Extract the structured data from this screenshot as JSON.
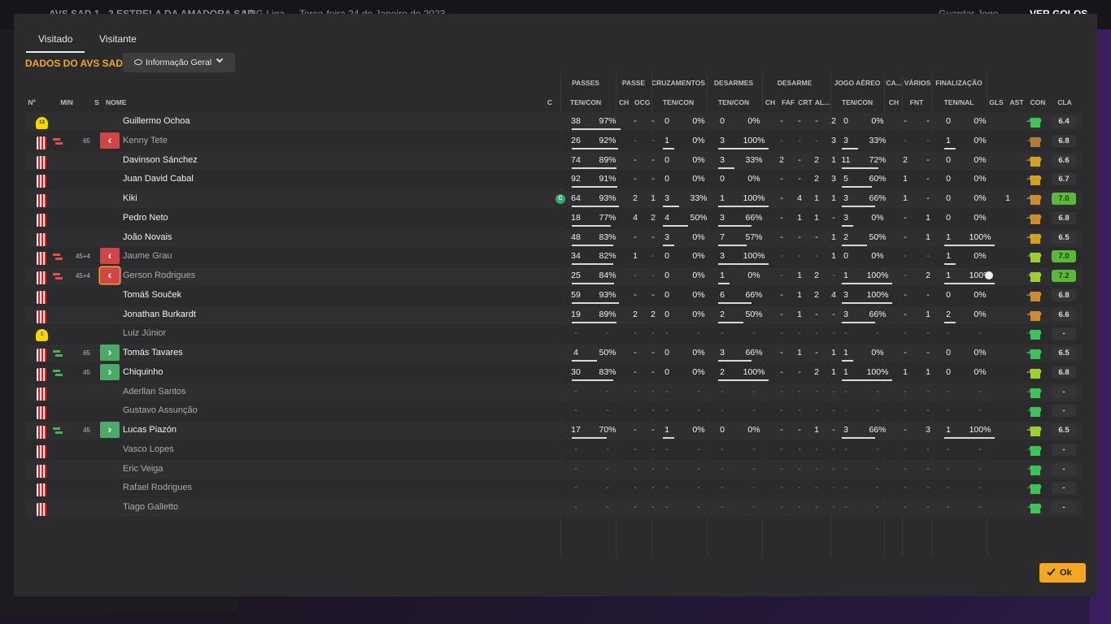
{
  "background": {
    "match": "AVS SAD  1 - 2  ESTRELA DA AMADORA SAD",
    "competition": "LPG Liga",
    "date": "Terça-feira 24 de Janeiro de 2023",
    "save_label": "Guardar Jogo",
    "goals_label": "VER GOLOS"
  },
  "tabs": [
    {
      "label": "Visitado",
      "active": true
    },
    {
      "label": "Visitante",
      "active": false
    }
  ],
  "title": "DADOS DO AVS SAD",
  "view_select": {
    "value": "Informação Geral"
  },
  "groups": {
    "passes": "PASSES",
    "passe": "PASSE",
    "cruz": "CRUZAMENTOS",
    "des": "DESARMES",
    "desarme": "DESARME",
    "aereo": "JOGO AÉREO",
    "ca": "CA...",
    "varios": "VÁRIOS",
    "final": "FINALIZAÇÃO"
  },
  "headers": {
    "num": "Nº",
    "min": "MIN",
    "s": "S",
    "nome": "NOME",
    "c": "C",
    "passes": "TEN/CON",
    "ch1": "CH",
    "ocg": "OCG",
    "cruz": "TEN/CON",
    "des": "TEN/CON",
    "ch2": "CH",
    "faf": "FAF",
    "crt": "CRT",
    "al": "AL...",
    "aereo": "TEN/CON",
    "ch3": "CH",
    "fnt": "FNT",
    "final": "TEN/NAL",
    "gls": "GLS",
    "ast": "AST",
    "con": "CON",
    "cla": "CLA"
  },
  "colors": {
    "accent": "#f5a623",
    "sub_in": "#4aaa66",
    "sub_out": "#d04545"
  },
  "players": [
    {
      "n": "13",
      "gk": true,
      "min": "",
      "sub": "",
      "name": "Guillermo Ochoa",
      "dim": false,
      "cap": false,
      "p": [
        "38",
        "97%",
        0.97
      ],
      "ch1": "-",
      "ocg": "-",
      "cz": [
        "0",
        "0%",
        0
      ],
      "ds": [
        "0",
        "0%",
        0
      ],
      "dch": "-",
      "faf": "-",
      "crt": "-",
      "al": "2",
      "ae": [
        "0",
        "0%",
        0
      ],
      "ca": "-",
      "fnt": "-",
      "fi": [
        "0",
        "0%",
        0
      ],
      "gls": "",
      "ast": "-",
      "con": "#3ec25a",
      "cla": "6.4",
      "good": false,
      "ball": false
    },
    {
      "n": "",
      "gk": false,
      "min": "65",
      "sub": "out",
      "name": "Kenny Tete",
      "dim": true,
      "cap": false,
      "p": [
        "26",
        "92%",
        0.92
      ],
      "ch1": "-",
      "ocg": "-",
      "cz": [
        "1",
        "0%",
        0
      ],
      "ds": [
        "3",
        "100%",
        1
      ],
      "dch": "-",
      "faf": "-",
      "crt": "-",
      "al": "3",
      "ae": [
        "3",
        "33%",
        0.33
      ],
      "ca": "-",
      "fnt": "-",
      "fi": [
        "1",
        "0%",
        0
      ],
      "gls": "",
      "ast": "-",
      "con": "#b07a3a",
      "cla": "6.8",
      "good": false,
      "ball": false
    },
    {
      "n": "",
      "gk": false,
      "min": "",
      "sub": "",
      "name": "Davinson Sánchez",
      "dim": false,
      "cap": false,
      "p": [
        "74",
        "89%",
        0.89
      ],
      "ch1": "-",
      "ocg": "-",
      "cz": [
        "0",
        "0%",
        0
      ],
      "ds": [
        "3",
        "33%",
        0.33
      ],
      "dch": "2",
      "faf": "-",
      "crt": "2",
      "al": "1",
      "ae": [
        "11",
        "72%",
        0.72
      ],
      "ca": "2",
      "fnt": "-",
      "fi": [
        "0",
        "0%",
        0
      ],
      "gls": "",
      "ast": "-",
      "con": "#d4a020",
      "cla": "6.6",
      "good": false,
      "ball": false
    },
    {
      "n": "",
      "gk": false,
      "min": "",
      "sub": "",
      "name": "Juan David Cabal",
      "dim": false,
      "cap": false,
      "p": [
        "92",
        "91%",
        0.91
      ],
      "ch1": "-",
      "ocg": "-",
      "cz": [
        "0",
        "0%",
        0
      ],
      "ds": [
        "0",
        "0%",
        0
      ],
      "dch": "-",
      "faf": "-",
      "crt": "2",
      "al": "3",
      "ae": [
        "5",
        "60%",
        0.6
      ],
      "ca": "1",
      "fnt": "-",
      "fi": [
        "0",
        "0%",
        0
      ],
      "gls": "",
      "ast": "-",
      "con": "#d4a020",
      "cla": "6.7",
      "good": false,
      "ball": false
    },
    {
      "n": "",
      "gk": false,
      "min": "",
      "sub": "",
      "name": "Kiki",
      "dim": false,
      "cap": true,
      "p": [
        "64",
        "93%",
        0.93
      ],
      "ch1": "2",
      "ocg": "1",
      "cz": [
        "3",
        "33%",
        0.33
      ],
      "ds": [
        "1",
        "100%",
        1
      ],
      "dch": "-",
      "faf": "4",
      "crt": "1",
      "al": "1",
      "ae": [
        "3",
        "66%",
        0.66
      ],
      "ca": "1",
      "fnt": "-",
      "fi": [
        "0",
        "0%",
        0
      ],
      "gls": "1",
      "ast": "-",
      "con": "#d08a30",
      "cla": "7.0",
      "good": true,
      "ball": false
    },
    {
      "n": "",
      "gk": false,
      "min": "",
      "sub": "",
      "name": "Pedro Neto",
      "dim": false,
      "cap": false,
      "p": [
        "18",
        "77%",
        0.77
      ],
      "ch1": "4",
      "ocg": "2",
      "cz": [
        "4",
        "50%",
        0.5
      ],
      "ds": [
        "3",
        "66%",
        0.66
      ],
      "dch": "-",
      "faf": "1",
      "crt": "1",
      "al": "-",
      "ae": [
        "3",
        "0%",
        0
      ],
      "ca": "-",
      "fnt": "1",
      "fi": [
        "0",
        "0%",
        0
      ],
      "gls": "",
      "ast": "-",
      "con": "#d08a30",
      "cla": "6.8",
      "good": false,
      "ball": false
    },
    {
      "n": "",
      "gk": false,
      "min": "",
      "sub": "",
      "name": "João Novais",
      "dim": false,
      "cap": false,
      "p": [
        "48",
        "83%",
        0.83
      ],
      "ch1": "-",
      "ocg": "-",
      "cz": [
        "3",
        "0%",
        0
      ],
      "ds": [
        "7",
        "57%",
        0.57
      ],
      "dch": "-",
      "faf": "-",
      "crt": "-",
      "al": "1",
      "ae": [
        "2",
        "50%",
        0.5
      ],
      "ca": "-",
      "fnt": "1",
      "fi": [
        "1",
        "100%",
        1
      ],
      "gls": "",
      "ast": "-",
      "con": "#d4a020",
      "cla": "6.5",
      "good": false,
      "ball": false
    },
    {
      "n": "",
      "gk": false,
      "min": "45+4",
      "sub": "out",
      "name": "Jaume Grau",
      "dim": true,
      "cap": false,
      "p": [
        "34",
        "82%",
        0.82
      ],
      "ch1": "1",
      "ocg": "-",
      "cz": [
        "0",
        "0%",
        0
      ],
      "ds": [
        "3",
        "100%",
        1
      ],
      "dch": "-",
      "faf": "-",
      "crt": "-",
      "al": "1",
      "ae": [
        "0",
        "0%",
        0
      ],
      "ca": "-",
      "fnt": "-",
      "fi": [
        "1",
        "0%",
        0
      ],
      "gls": "",
      "ast": "-",
      "con": "#9ad030",
      "cla": "7.0",
      "good": true,
      "ball": false
    },
    {
      "n": "",
      "gk": false,
      "min": "45+4",
      "sub": "out",
      "hl": true,
      "name": "Gerson Rodrigues",
      "dim": true,
      "cap": false,
      "p": [
        "25",
        "84%",
        0.84
      ],
      "ch1": "-",
      "ocg": "-",
      "cz": [
        "0",
        "0%",
        0
      ],
      "ds": [
        "1",
        "0%",
        0
      ],
      "dch": "-",
      "faf": "1",
      "crt": "2",
      "al": "-",
      "ae": [
        "1",
        "100%",
        1
      ],
      "ca": "-",
      "fnt": "2",
      "fi": [
        "1",
        "100%",
        1
      ],
      "gls": "",
      "ast": "-",
      "con": "#9ad030",
      "cla": "7.2",
      "good": true,
      "ball": true
    },
    {
      "n": "",
      "gk": false,
      "min": "",
      "sub": "",
      "name": "Tomáš Souček",
      "dim": false,
      "cap": false,
      "p": [
        "59",
        "93%",
        0.93
      ],
      "ch1": "-",
      "ocg": "-",
      "cz": [
        "0",
        "0%",
        0
      ],
      "ds": [
        "6",
        "66%",
        0.66
      ],
      "dch": "-",
      "faf": "1",
      "crt": "2",
      "al": "4",
      "ae": [
        "3",
        "100%",
        1
      ],
      "ca": "-",
      "fnt": "-",
      "fi": [
        "0",
        "0%",
        0
      ],
      "gls": "",
      "ast": "-",
      "con": "#d08a30",
      "cla": "6.8",
      "good": false,
      "ball": false
    },
    {
      "n": "",
      "gk": false,
      "min": "",
      "sub": "",
      "name": "Jonathan Burkardt",
      "dim": false,
      "cap": false,
      "p": [
        "19",
        "89%",
        0.89
      ],
      "ch1": "2",
      "ocg": "2",
      "cz": [
        "0",
        "0%",
        0
      ],
      "ds": [
        "2",
        "50%",
        0.5
      ],
      "dch": "-",
      "faf": "1",
      "crt": "-",
      "al": "-",
      "ae": [
        "3",
        "66%",
        0.66
      ],
      "ca": "-",
      "fnt": "1",
      "fi": [
        "2",
        "0%",
        0
      ],
      "gls": "",
      "ast": "-",
      "con": "#d08a30",
      "cla": "6.6",
      "good": false,
      "ball": false
    },
    {
      "n": "1",
      "gk": true,
      "min": "",
      "sub": "",
      "name": "Luiz Júnior",
      "dim": true,
      "cap": false,
      "p": [
        "-",
        "-",
        0
      ],
      "ch1": "-",
      "ocg": "-",
      "cz": [
        "-",
        "-",
        0
      ],
      "ds": [
        "-",
        "-",
        0
      ],
      "dch": "-",
      "faf": "-",
      "crt": "-",
      "al": "-",
      "ae": [
        "-",
        "-",
        0
      ],
      "ca": "-",
      "fnt": "-",
      "fi": [
        "-",
        "-",
        0
      ],
      "gls": "",
      "ast": "-",
      "con": "#3ec25a",
      "cla": "-",
      "good": false,
      "ball": false
    },
    {
      "n": "",
      "gk": false,
      "min": "65",
      "sub": "in",
      "name": "Tomás Tavares",
      "dim": false,
      "cap": false,
      "p": [
        "4",
        "50%",
        0.5
      ],
      "ch1": "-",
      "ocg": "-",
      "cz": [
        "0",
        "0%",
        0
      ],
      "ds": [
        "3",
        "66%",
        0.66
      ],
      "dch": "-",
      "faf": "1",
      "crt": "-",
      "al": "1",
      "ae": [
        "1",
        "0%",
        0
      ],
      "ca": "-",
      "fnt": "-",
      "fi": [
        "0",
        "0%",
        0
      ],
      "gls": "",
      "ast": "-",
      "con": "#3ec25a",
      "cla": "6.5",
      "good": false,
      "ball": false
    },
    {
      "n": "",
      "gk": false,
      "min": "45",
      "sub": "in",
      "name": "Chiquinho",
      "dim": false,
      "cap": false,
      "p": [
        "30",
        "83%",
        0.83
      ],
      "ch1": "-",
      "ocg": "-",
      "cz": [
        "0",
        "0%",
        0
      ],
      "ds": [
        "2",
        "100%",
        1
      ],
      "dch": "-",
      "faf": "-",
      "crt": "2",
      "al": "1",
      "ae": [
        "1",
        "100%",
        1
      ],
      "ca": "1",
      "fnt": "1",
      "fi": [
        "0",
        "0%",
        0
      ],
      "gls": "",
      "ast": "-",
      "con": "#9ad030",
      "cla": "6.8",
      "good": false,
      "ball": false
    },
    {
      "n": "",
      "gk": false,
      "min": "",
      "sub": "",
      "name": "Aderllan Santos",
      "dim": true,
      "cap": false,
      "p": [
        "-",
        "-",
        0
      ],
      "ch1": "-",
      "ocg": "-",
      "cz": [
        "-",
        "-",
        0
      ],
      "ds": [
        "-",
        "-",
        0
      ],
      "dch": "-",
      "faf": "-",
      "crt": "-",
      "al": "-",
      "ae": [
        "-",
        "-",
        0
      ],
      "ca": "-",
      "fnt": "-",
      "fi": [
        "-",
        "-",
        0
      ],
      "gls": "",
      "ast": "-",
      "con": "#3ec25a",
      "cla": "-",
      "good": false,
      "ball": false
    },
    {
      "n": "",
      "gk": false,
      "min": "",
      "sub": "",
      "name": "Gustavo Assunção",
      "dim": true,
      "cap": false,
      "p": [
        "-",
        "-",
        0
      ],
      "ch1": "-",
      "ocg": "-",
      "cz": [
        "-",
        "-",
        0
      ],
      "ds": [
        "-",
        "-",
        0
      ],
      "dch": "-",
      "faf": "-",
      "crt": "-",
      "al": "-",
      "ae": [
        "-",
        "-",
        0
      ],
      "ca": "-",
      "fnt": "-",
      "fi": [
        "-",
        "-",
        0
      ],
      "gls": "",
      "ast": "-",
      "con": "#3ec25a",
      "cla": "-",
      "good": false,
      "ball": false
    },
    {
      "n": "",
      "gk": false,
      "min": "45",
      "sub": "in",
      "name": "Lucas Piazón",
      "dim": false,
      "cap": false,
      "p": [
        "17",
        "70%",
        0.7
      ],
      "ch1": "-",
      "ocg": "-",
      "cz": [
        "1",
        "0%",
        0
      ],
      "ds": [
        "0",
        "0%",
        0
      ],
      "dch": "-",
      "faf": "-",
      "crt": "1",
      "al": "-",
      "ae": [
        "3",
        "66%",
        0.66
      ],
      "ca": "-",
      "fnt": "3",
      "fi": [
        "1",
        "100%",
        1
      ],
      "gls": "",
      "ast": "-",
      "con": "#9ad030",
      "cla": "6.5",
      "good": false,
      "ball": false
    },
    {
      "n": "",
      "gk": false,
      "min": "",
      "sub": "",
      "name": "Vasco Lopes",
      "dim": true,
      "cap": false,
      "p": [
        "-",
        "-",
        0
      ],
      "ch1": "-",
      "ocg": "-",
      "cz": [
        "-",
        "-",
        0
      ],
      "ds": [
        "-",
        "-",
        0
      ],
      "dch": "-",
      "faf": "-",
      "crt": "-",
      "al": "-",
      "ae": [
        "-",
        "-",
        0
      ],
      "ca": "-",
      "fnt": "-",
      "fi": [
        "-",
        "-",
        0
      ],
      "gls": "",
      "ast": "-",
      "con": "#3ec25a",
      "cla": "-",
      "good": false,
      "ball": false
    },
    {
      "n": "",
      "gk": false,
      "min": "",
      "sub": "",
      "name": "Eric Veiga",
      "dim": true,
      "cap": false,
      "p": [
        "-",
        "-",
        0
      ],
      "ch1": "-",
      "ocg": "-",
      "cz": [
        "-",
        "-",
        0
      ],
      "ds": [
        "-",
        "-",
        0
      ],
      "dch": "-",
      "faf": "-",
      "crt": "-",
      "al": "-",
      "ae": [
        "-",
        "-",
        0
      ],
      "ca": "-",
      "fnt": "-",
      "fi": [
        "-",
        "-",
        0
      ],
      "gls": "",
      "ast": "-",
      "con": "#3ec25a",
      "cla": "-",
      "good": false,
      "ball": false
    },
    {
      "n": "",
      "gk": false,
      "min": "",
      "sub": "",
      "name": "Rafael Rodrigues",
      "dim": true,
      "cap": false,
      "p": [
        "-",
        "-",
        0
      ],
      "ch1": "-",
      "ocg": "-",
      "cz": [
        "-",
        "-",
        0
      ],
      "ds": [
        "-",
        "-",
        0
      ],
      "dch": "-",
      "faf": "-",
      "crt": "-",
      "al": "-",
      "ae": [
        "-",
        "-",
        0
      ],
      "ca": "-",
      "fnt": "-",
      "fi": [
        "-",
        "-",
        0
      ],
      "gls": "",
      "ast": "-",
      "con": "#3ec25a",
      "cla": "-",
      "good": false,
      "ball": false
    },
    {
      "n": "",
      "gk": false,
      "min": "",
      "sub": "",
      "name": "Tiago Galletto",
      "dim": true,
      "cap": false,
      "p": [
        "-",
        "-",
        0
      ],
      "ch1": "-",
      "ocg": "-",
      "cz": [
        "-",
        "-",
        0
      ],
      "ds": [
        "-",
        "-",
        0
      ],
      "dch": "-",
      "faf": "-",
      "crt": "-",
      "al": "-",
      "ae": [
        "-",
        "-",
        0
      ],
      "ca": "-",
      "fnt": "-",
      "fi": [
        "-",
        "-",
        0
      ],
      "gls": "",
      "ast": "-",
      "con": "#3ec25a",
      "cla": "-",
      "good": false,
      "ball": false
    }
  ],
  "ok_label": "Ok"
}
